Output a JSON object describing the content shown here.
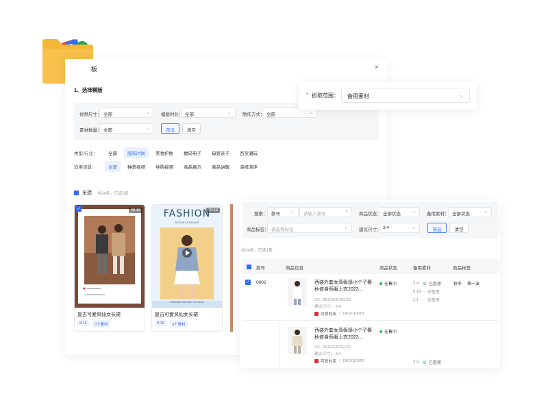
{
  "dialog": {
    "title_fragment": "板",
    "close_label": "×",
    "step1_title": "1、选择模版"
  },
  "template_filter": {
    "size_label": "视频尺寸：",
    "size_value": "全部",
    "duration_label": "模版时长：",
    "duration_value": "全部",
    "method_label": "制作方式：",
    "method_value": "全部",
    "count_label": "素材数量：",
    "count_value": "全部",
    "filter_btn": "筛选",
    "clear_btn": "清空"
  },
  "category_row": {
    "label": "类型/行业：",
    "items": [
      "全部",
      "服饰时尚",
      "美妆护肤",
      "数码电子",
      "母婴亲子",
      "百货潮玩"
    ],
    "active_index": 1
  },
  "scene_row": {
    "label": "适用场景：",
    "items": [
      "全部",
      "种草视频",
      "导购视频",
      "商品展示",
      "商品讲解",
      "演绎测评"
    ],
    "active_index": 0
  },
  "select_all": {
    "label": "全选",
    "summary": "共24条，已选3条"
  },
  "cards": [
    {
      "duration": "00:16",
      "name": "复古可爱风仙女长裙",
      "ratio": "9:16",
      "material": "3个素材"
    },
    {
      "duration": "00:16",
      "name": "复古可爱风仙女长裙",
      "ratio": "9:16",
      "material": "3个素材",
      "poster_title": "FASHION",
      "poster_sub": "ELEGANT & RADIANT",
      "poster_foot": "FORTUNE FAVORS THE BOLD"
    }
  ],
  "range": {
    "label": "抓取范围：",
    "value": "备用素材"
  },
  "product_filter": {
    "search_label": "搜索：",
    "search_field": "款号",
    "search_placeholder": "请输入款号",
    "status_label": "商品状态：",
    "status_value": "全部状态",
    "material_label": "备用素材：",
    "material_value": "全部状态",
    "tag_label": "商品标签：",
    "tag_placeholder": "请选择标签",
    "size_label": "建议尺寸：",
    "size_value": "3:4",
    "filter_btn": "筛选",
    "clear_btn": "清空"
  },
  "product_count": "共24条，已选1条",
  "table": {
    "headers": [
      "款号",
      "商品信息",
      "商品状态",
      "备用素材",
      "商品标签"
    ],
    "rows": [
      {
        "sku": "0002",
        "title": "西装外套女高级感小个子春秋修身西服上衣2023...",
        "id": "ID：DESCENTE123",
        "suggest": "建议尺寸：  3:4",
        "shop": "可爱的店",
        "brand": "DESCENTE",
        "status": "在售中",
        "materials": [
          {
            "ratio": "3:4",
            "state": "已整理",
            "ok": true
          },
          {
            "ratio": "9:16",
            "state": "未整理",
            "ok": false
          },
          {
            "ratio": "1:1",
            "state": "未整理",
            "ok": false
          }
        ],
        "tags": [
          "秋冬",
          "第一波"
        ]
      },
      {
        "title": "西装外套女高级感小个子春秋修身西服上衣2023...",
        "id": "ID：DESCENTE123",
        "suggest": "建议尺寸：  3:4",
        "shop": "可爱的店",
        "brand": "DESCENTE",
        "status": "在售中",
        "materials": [
          {
            "ratio": "3:4",
            "state": "已整理",
            "ok": true
          }
        ]
      }
    ]
  },
  "colors": {
    "accent": "#2f6bf2",
    "success": "#2fb865",
    "required": "#f04848",
    "folder": "#f5b735"
  }
}
